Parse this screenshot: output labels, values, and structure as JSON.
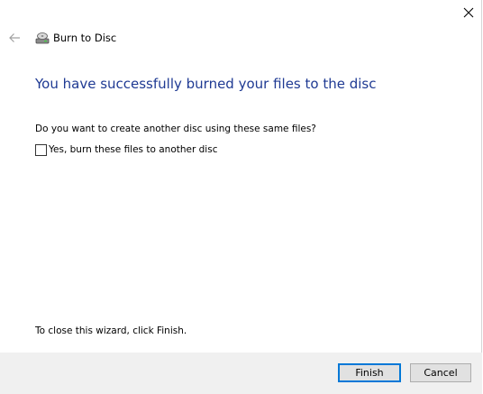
{
  "wizard": {
    "title": "Burn to Disc",
    "heading": "You have successfully burned your files to the disc",
    "question": "Do you want to create another disc using these same files?",
    "checkbox_label": "Yes, burn these files to another disc",
    "checkbox_checked": false,
    "close_hint": "To close this wizard, click Finish."
  },
  "buttons": {
    "finish": "Finish",
    "cancel": "Cancel"
  },
  "icons": {
    "close": "close-icon",
    "back": "back-arrow-icon",
    "title": "disc-drive-icon"
  },
  "colors": {
    "heading": "#1f3a93",
    "footer_bg": "#f0f0f0",
    "default_button_border": "#0078d7"
  }
}
